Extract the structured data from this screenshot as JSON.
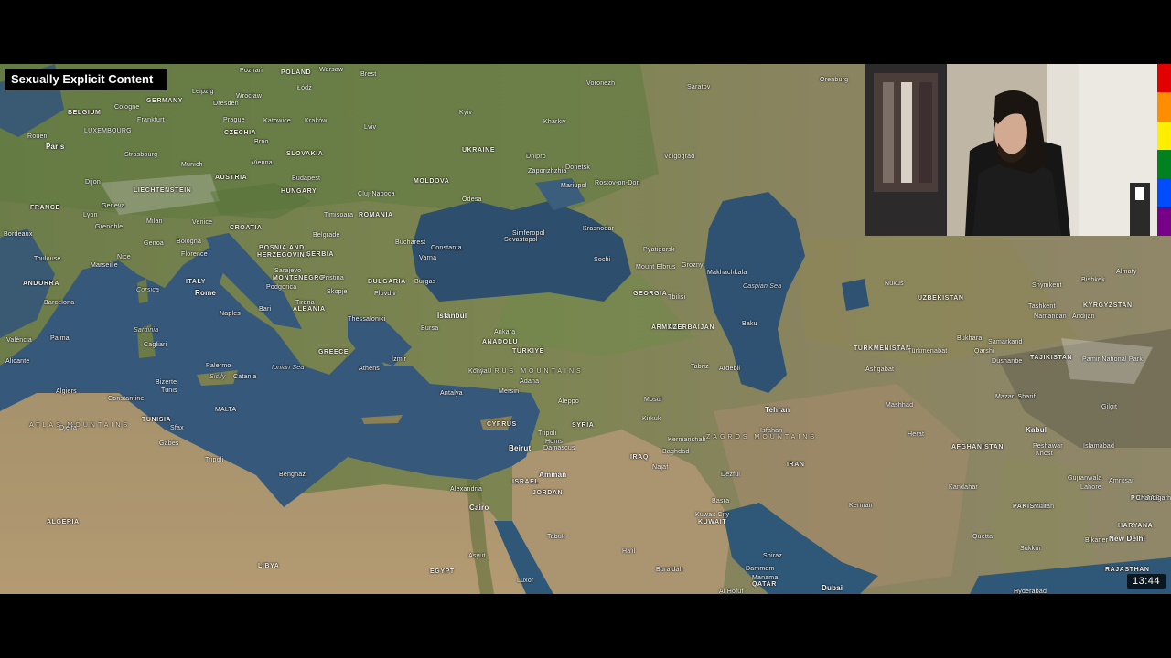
{
  "overlay": {
    "content_warning": "Sexually Explicit Content"
  },
  "player": {
    "timestamp": "13:44"
  },
  "rainbow_colors": [
    "#e50000",
    "#ff8d00",
    "#ffee00",
    "#028121",
    "#004cff",
    "#770088"
  ],
  "map_labels": {
    "poland": "POLAND",
    "germany": "GERMANY",
    "belgium": "BELGIUM",
    "luxembourg": "LUXEMBOURG",
    "czechia": "CZECHIA",
    "slovakia": "SLOVAKIA",
    "austria": "AUSTRIA",
    "hungary": "HUNGARY",
    "liechtenstein": "LIECHTENSTEIN",
    "france": "FRANCE",
    "croatia": "CROATIA",
    "bosnia1": "BOSNIA AND",
    "bosnia2": "HERZEGOVINA",
    "serbia": "SERBIA",
    "romania": "ROMANIA",
    "moldova": "MOLDOVA",
    "ukraine": "UKRAINE",
    "montenegro": "MONTENEGRO",
    "bulgaria": "BULGARIA",
    "italy": "ITALY",
    "andorra": "ANDORRA",
    "albania": "ALBANIA",
    "greece": "GREECE",
    "turkiye": "TÜRKIYE",
    "anadolu": "ANADOLU",
    "georgia": "GEORGIA",
    "armenia": "ARMENIA",
    "azerbaijan": "AZERBAIJAN",
    "uzbekistan": "UZBEKISTAN",
    "kyrgyzstan": "KYRGYZSTAN",
    "turkmenistan": "TURKMENISTAN",
    "tajikistan": "TAJIKISTAN",
    "afghanistan": "AFGHANISTAN",
    "pakistan": "PAKISTAN",
    "iran": "IRAN",
    "iraq": "IRAQ",
    "syria": "SYRIA",
    "cyprus": "CYPRUS",
    "israel": "ISRAEL",
    "jordan": "JORDAN",
    "kuwait": "KUWAIT",
    "qatar": "QATAR",
    "punjab": "PUNJAB",
    "haryana": "HARYANA",
    "rajasthan": "RAJASTHAN",
    "tunisia": "TUNISIA",
    "algeria": "ALGERIA",
    "libya": "LIBYA",
    "egypt": "EGYPT",
    "malta": "MALTA",
    "sicily": "Sicily",
    "sardinia": "Sardinia",
    "corsica": "Corsica",
    "taurus_mountains": "TAURUS MOUNTAINS",
    "zagros_mountains": "ZAGROS MOUNTAINS",
    "atlas_mountains": "ATLAS MOUNTAINS",
    "ionian_sea": "Ionian Sea",
    "caspian_sea": "Caspian Sea",
    "warsaw": "Warsaw",
    "poznan": "Poznań",
    "brest": "Brest",
    "lodz": "Łódź",
    "leipzig": "Leipzig",
    "dresden": "Dresden",
    "wroclaw": "Wrocław",
    "cologne": "Cologne",
    "frankfurt": "Frankfurt",
    "prague": "Prague",
    "katowice": "Katowice",
    "krakow": "Kraków",
    "brno": "Brno",
    "lviv": "Lviv",
    "kyiv": "Kyiv",
    "kharkiv": "Kharkiv",
    "voronezh": "Voronezh",
    "saratov": "Saratov",
    "orenburg": "Orenburg",
    "paris": "Paris",
    "rouen": "Rouen",
    "strasbourg": "Strasbourg",
    "munich": "Munich",
    "vienna": "Vienna",
    "dijon": "Dijon",
    "geneva": "Geneva",
    "lyon": "Lyon",
    "grenoble": "Grenoble",
    "milan": "Milan",
    "venice": "Venice",
    "budapest": "Budapest",
    "cluj": "Cluj-Napoca",
    "timisoara": "Timișoara",
    "bucharest": "Bucharest",
    "belgrade": "Belgrade",
    "odesa": "Odesa",
    "dnipro": "Dnipro",
    "zaporizhzhia": "Zaporizhzhia",
    "donetsk": "Donetsk",
    "mariupol": "Mariupol",
    "rostov": "Rostov-on-Don",
    "volgograd": "Volgograd",
    "simferopol": "Simferopol",
    "sevastopol": "Sevastopol",
    "krasnodar": "Krasnodar",
    "sochi": "Sochi",
    "pyatigorsk": "Pyatigorsk",
    "elbrus": "Mount Elbrus",
    "grozny": "Grozny",
    "makhachkala": "Makhachkala",
    "bordeaux": "Bordeaux",
    "toulouse": "Toulouse",
    "marseille": "Marseille",
    "nice": "Nice",
    "genoa": "Genoa",
    "bologna": "Bologna",
    "florence": "Florence",
    "sarajevo": "Sarajevo",
    "constanta": "Constanța",
    "varna": "Varna",
    "burgas": "Burgas",
    "podgorica": "Podgorica",
    "pristina": "Pristina",
    "skopje": "Skopje",
    "plovdiv": "Plovdiv",
    "tirana": "Tirana",
    "thessaloniki": "Thessaloniki",
    "istanbul": "İstanbul",
    "bursa": "Bursa",
    "ankara": "Ankara",
    "tbilisi": "Tbilisi",
    "baku": "Baku",
    "barcelona": "Barcelona",
    "rome": "Rome",
    "naples": "Naples",
    "bari": "Bari",
    "valencia": "València",
    "palma": "Palma",
    "cagliari": "Cagliari",
    "alicante": "Alicante",
    "palermo": "Palermo",
    "catania": "Catania",
    "athens": "Athens",
    "izmir": "İzmir",
    "konya": "Konya",
    "antalya": "Antalya",
    "mersin": "Mersin",
    "adana": "Adana",
    "aleppo": "Aleppo",
    "tabriz": "Tabriz",
    "ardebil": "Ardebil",
    "tehran": "Tehran",
    "mosul": "Mosul",
    "kirkuk": "Kirkuk",
    "kermanshah": "Kermanshah",
    "baghdad": "Baghdad",
    "beirut": "Beirut",
    "damascus": "Damascus",
    "amman": "Amman",
    "cairo": "Cairo",
    "alexandria": "Alexandria",
    "tripoli_lb": "Tripoli",
    "homs": "Homs",
    "tripoli_ly": "Tripoli",
    "benghazi": "Benghazi",
    "algiers": "Algiers",
    "constantine": "Constantine",
    "bizerte": "Bizerte",
    "tunis": "Tunis",
    "sfax": "Sfax",
    "gabes": "Gabès",
    "djelfa": "Djelfa",
    "nukus": "Nukus",
    "tashkent": "Tashkent",
    "bishkek": "Bishkek",
    "almaty": "Almaty",
    "shymkent": "Shymkent",
    "namangan": "Namangan",
    "andijan": "Andijan",
    "samarkand": "Samarkand",
    "bukhara": "Bukhara",
    "turkmenabat": "Türkmenabat",
    "ashgabat": "Ashgabat",
    "mashhad": "Mashhad",
    "dushanbe": "Dushanbe",
    "qarshi": "Qarshi",
    "mazari_sharif": "Mazari Sharif",
    "kabul": "Kabul",
    "herat": "Herat",
    "peshawar": "Peshawar",
    "islamabad": "Islamabad",
    "lahore": "Lahore",
    "gujranwala": "Gujranwala",
    "amritsar": "Amritsar",
    "chandigarh": "Chandigarh",
    "new_delhi": "New Delhi",
    "kandahar": "Kandahar",
    "quetta": "Quetta",
    "multan": "Multan",
    "bikaner": "Bikaner",
    "sukkur": "Sukkur",
    "hyderabad": "Hyderabad",
    "kerman": "Kerman",
    "isfahan": "Isfahan",
    "shiraz": "Shiraz",
    "basra": "Basra",
    "kuwait_city": "Kuwait City",
    "dammam": "Dammam",
    "manama": "Manama",
    "dubai": "Dubai",
    "hail": "Ha'il",
    "buraidah": "Buraidah",
    "tabuk": "Tabuk",
    "luxor": "Luxor",
    "asyut": "Asyut",
    "al_hofuf": "Al Hofuf",
    "pamir": "Pamir National Park",
    "khost": "Khost",
    "gilgit": "Gilgit",
    "najaf": "Najaf",
    "dezful": "Dezful"
  }
}
